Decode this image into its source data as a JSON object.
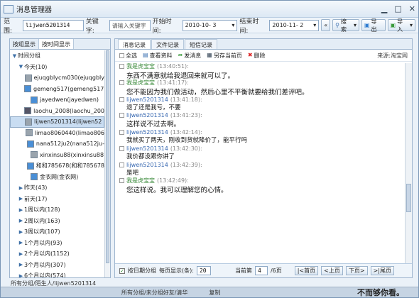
{
  "window": {
    "title": "消息管理器"
  },
  "filter": {
    "range_label": "范 围:",
    "range_value": "lijwen5201314",
    "keyword_label": "关键字:",
    "keyword_placeholder": "请输入关键字",
    "start_label": "开始时间:",
    "start_value": "2010-10- 3",
    "end_label": "结束时间:",
    "end_value": "2010-11- 2",
    "prev_label": "«",
    "search_label": "搜索",
    "export_label": "导出",
    "import_label": "导入"
  },
  "left_tabs": [
    {
      "label": "按组显示"
    },
    {
      "label": "按时间显示"
    }
  ],
  "tree": [
    {
      "label": "时间分组",
      "arrow": "▼",
      "indent": 0,
      "avatar": false
    },
    {
      "label": "今天(10)",
      "arrow": "▼",
      "indent": 1,
      "avatar": false
    },
    {
      "label": "ejuqgblycm030(ejuqgbly",
      "arrow": "",
      "indent": 2,
      "avatar": true,
      "color": "#9aa4ad"
    },
    {
      "label": "gemeng517(gemeng517)",
      "arrow": "",
      "indent": 2,
      "avatar": true,
      "color": "#4a8fd6"
    },
    {
      "label": "jayedwen(jayedwen)",
      "arrow": "",
      "indent": 2,
      "avatar": true,
      "color": "#4a8fd6"
    },
    {
      "label": "laochu_2008(laochu_200",
      "arrow": "",
      "indent": 2,
      "avatar": true,
      "color": "#556"
    },
    {
      "label": "lijwen5201314(lijwen52",
      "arrow": "",
      "indent": 2,
      "avatar": true,
      "color": "#9aa4ad",
      "selected": true
    },
    {
      "label": "limao8060440(limao806",
      "arrow": "",
      "indent": 2,
      "avatar": true,
      "color": "#9aa4ad"
    },
    {
      "label": "nana512ju2(nana512ju-",
      "arrow": "",
      "indent": 2,
      "avatar": true,
      "color": "#4a8fd6"
    },
    {
      "label": "xinxinsu88(xinxinsu88",
      "arrow": "",
      "indent": 2,
      "avatar": true,
      "color": "#9aa4ad"
    },
    {
      "label": "和和785678(和和785678",
      "arrow": "",
      "indent": 2,
      "avatar": true,
      "color": "#4a8fd6"
    },
    {
      "label": "金衣网(金衣网)",
      "arrow": "",
      "indent": 2,
      "avatar": true,
      "color": "#4a8fd6"
    },
    {
      "label": "昨天(43)",
      "arrow": "▶",
      "indent": 1,
      "avatar": false
    },
    {
      "label": "前天(17)",
      "arrow": "▶",
      "indent": 1,
      "avatar": false
    },
    {
      "label": "1周以内(128)",
      "arrow": "▶",
      "indent": 1,
      "avatar": false
    },
    {
      "label": "2周以内(163)",
      "arrow": "▶",
      "indent": 1,
      "avatar": false
    },
    {
      "label": "3周以内(107)",
      "arrow": "▶",
      "indent": 1,
      "avatar": false
    },
    {
      "label": "1个月以内(93)",
      "arrow": "▶",
      "indent": 1,
      "avatar": false
    },
    {
      "label": "2个月以内(1152)",
      "arrow": "▶",
      "indent": 1,
      "avatar": false
    },
    {
      "label": "3个月以内(307)",
      "arrow": "▶",
      "indent": 1,
      "avatar": false
    },
    {
      "label": "6个月以内(574)",
      "arrow": "▶",
      "indent": 1,
      "avatar": false
    }
  ],
  "right_tabs": [
    {
      "label": "消息记录"
    },
    {
      "label": "文件记录"
    },
    {
      "label": "短信记录"
    }
  ],
  "toolbar": {
    "select_all": "全选",
    "view_profile": "查看资料",
    "send_msg": "发消息",
    "save_page": "另存当前页",
    "delete": "删除",
    "source": "来源:淘宝网"
  },
  "messages": [
    {
      "sender": "我是虎宝宝",
      "time": "(13:40:51):",
      "text": "东西不满意就给我退回来就可以了。",
      "self": true,
      "small": false
    },
    {
      "sender": "我是虎宝宝",
      "time": "(13:41:17):",
      "text": "您不能因为我们做活动，然后心里不平衡就要给我们差评吧。",
      "self": true,
      "small": false
    },
    {
      "sender": "lijwen5201314",
      "time": "(13:41:18):",
      "text": "退了还是我亏，不要",
      "self": false,
      "small": true
    },
    {
      "sender": "lijwen5201314",
      "time": "(13:41:23):",
      "text": "这样说不过去啊。",
      "self": false,
      "small": false
    },
    {
      "sender": "lijwen5201314",
      "time": "(13:42:14):",
      "text": "我就买了两天，刚收到货就降价了，能平行吗",
      "self": false,
      "small": true
    },
    {
      "sender": "lijwen5201314",
      "time": "(13:42:30):",
      "text": "我价都没跟你讲了",
      "self": false,
      "small": true
    },
    {
      "sender": "lijwen5201314",
      "time": "(13:42:39):",
      "text": "是吧",
      "self": false,
      "small": true
    },
    {
      "sender": "我是虎宝宝",
      "time": "(13:42:49):",
      "text": "您这样说。我可以理解您的心情。",
      "self": true,
      "small": false
    }
  ],
  "pager": {
    "by_date_label": "按日期分组",
    "per_page_label": "每页显示(条):",
    "per_page_value": "20",
    "current_label": "当前第",
    "current_value": "4",
    "total_label": "/6页",
    "first": "|<首页",
    "prev": "<上页",
    "next": "下页>",
    "last": ">|尾页"
  },
  "status": "所有分组/陌生人/lijwen5201314",
  "outside": {
    "left": "所有分组/未分组好友/清华",
    "mid": "复制",
    "right": "不而够你看。"
  }
}
